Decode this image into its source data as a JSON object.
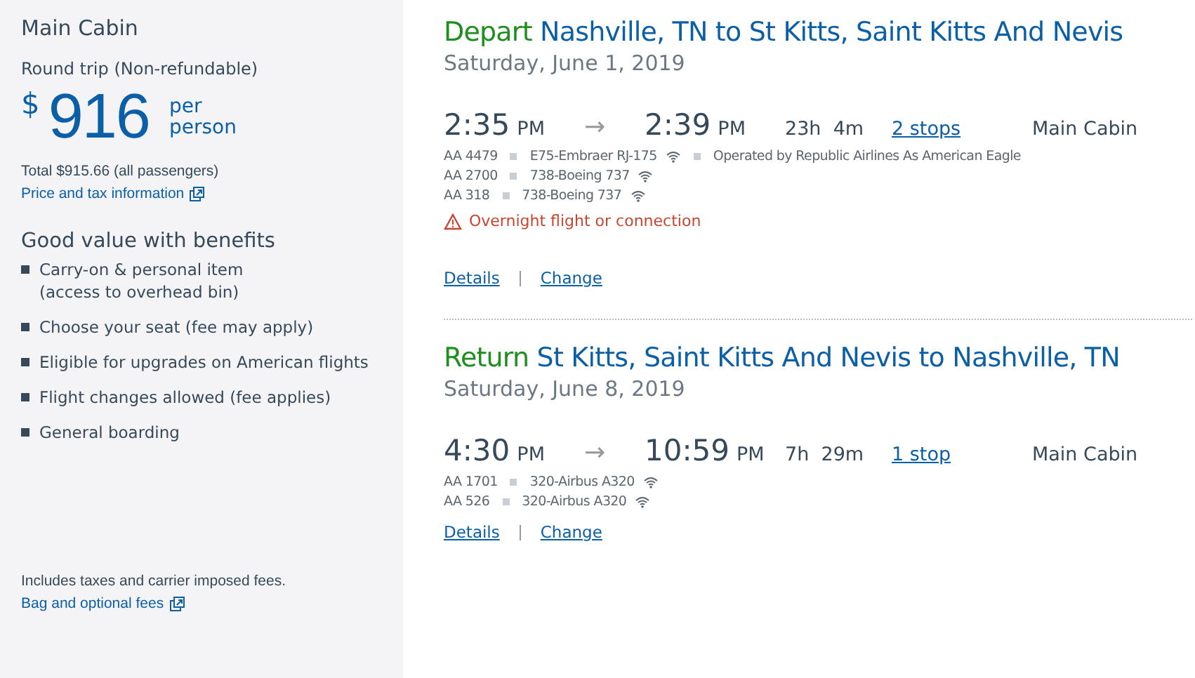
{
  "fare": {
    "cabin": "Main Cabin",
    "trip_type": "Round trip (Non-refundable)",
    "currency": "$",
    "amount": "916",
    "per_label": [
      "per",
      "person"
    ],
    "total": "Total $915.66 (all passengers)",
    "price_link": "Price and tax information",
    "benefits_title": "Good value with benefits",
    "benefits": [
      [
        "Carry-on & personal item",
        "(access to overhead bin)"
      ],
      [
        "Choose your seat (fee may apply)"
      ],
      [
        "Eligible for upgrades on American flights"
      ],
      [
        "Flight changes allowed (fee applies)"
      ],
      [
        "General boarding"
      ]
    ],
    "footnote": "Includes taxes and carrier imposed fees.",
    "bag_link": "Bag and optional fees"
  },
  "slices": [
    {
      "direction": "Depart",
      "route": "Nashville, TN to St Kitts, Saint Kitts And Nevis",
      "date": "Saturday, June 1, 2019",
      "depart_time": "2:35",
      "depart_meridiem": "PM",
      "arrow": "→",
      "arrive_time": "2:39",
      "arrive_meridiem": "PM",
      "duration": "23h  4m",
      "stops": "2 stops",
      "cabin": "Main Cabin",
      "segments": [
        {
          "flight": "AA 4479",
          "aircraft": "E75-Embraer RJ-175",
          "wifi": true,
          "operator": "Operated by Republic Airlines As American Eagle"
        },
        {
          "flight": "AA 2700",
          "aircraft": "738-Boeing 737",
          "wifi": true
        },
        {
          "flight": "AA 318",
          "aircraft": "738-Boeing 737",
          "wifi": true
        }
      ],
      "warning": "Overnight flight or connection",
      "links": [
        "Details",
        "Change"
      ]
    },
    {
      "direction": "Return",
      "route": "St Kitts, Saint Kitts And Nevis to Nashville, TN",
      "date": "Saturday, June 8, 2019",
      "depart_time": "4:30",
      "depart_meridiem": "PM",
      "arrow": "→",
      "arrive_time": "10:59",
      "arrive_meridiem": "PM",
      "duration": "7h  29m",
      "stops": "1 stop",
      "cabin": "Main Cabin",
      "segments": [
        {
          "flight": "AA 1701",
          "aircraft": "320-Airbus A320",
          "wifi": true
        },
        {
          "flight": "AA 526",
          "aircraft": "320-Airbus A320",
          "wifi": true
        }
      ],
      "links": [
        "Details",
        "Change"
      ]
    }
  ]
}
